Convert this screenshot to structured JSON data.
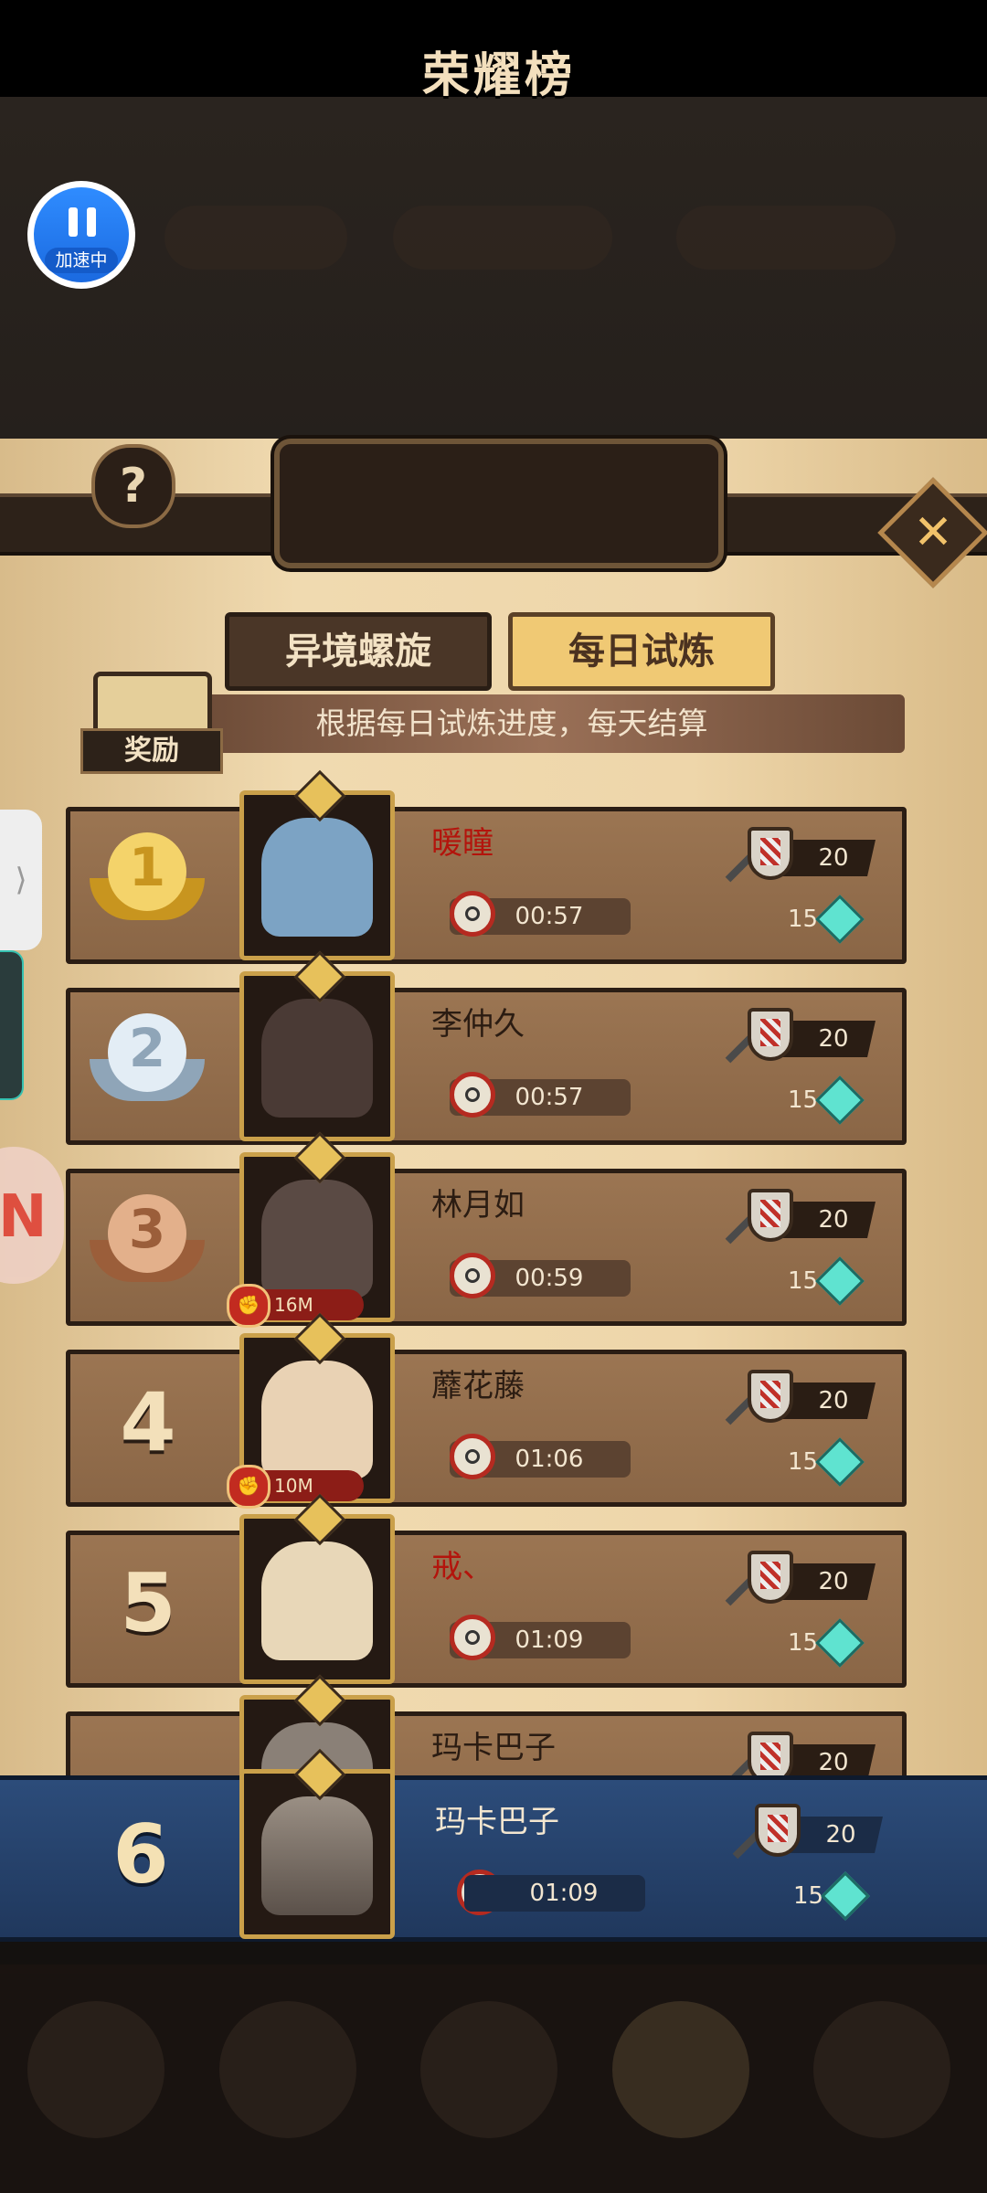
{
  "overlay": {
    "speed_badge_label": "加速中"
  },
  "panel": {
    "title": "荣耀榜",
    "help_label": "?",
    "close_label": "✕",
    "tabs": [
      {
        "label": "异境螺旋",
        "active": false
      },
      {
        "label": "每日试炼",
        "active": true
      }
    ],
    "reward_label": "奖励",
    "subtitle": "根据每日试炼进度，每天结算"
  },
  "rows": [
    {
      "rank": "1",
      "name": "暖瞳",
      "name_red": true,
      "time": "00:57",
      "shield": "20",
      "gem": "15",
      "power": ""
    },
    {
      "rank": "2",
      "name": "李仲久",
      "name_red": false,
      "time": "00:57",
      "shield": "20",
      "gem": "15",
      "power": ""
    },
    {
      "rank": "3",
      "name": "林月如",
      "name_red": false,
      "time": "00:59",
      "shield": "20",
      "gem": "15",
      "power": "16M"
    },
    {
      "rank": "4",
      "name": "蘼花藤",
      "name_red": false,
      "time": "01:06",
      "shield": "20",
      "gem": "15",
      "power": "10M"
    },
    {
      "rank": "5",
      "name": "戒、",
      "name_red": true,
      "time": "01:09",
      "shield": "20",
      "gem": "15",
      "power": ""
    },
    {
      "rank": "",
      "name": "玛卡巴子",
      "name_red": false,
      "time": "",
      "shield": "20",
      "gem": "",
      "power": ""
    }
  ],
  "self": {
    "rank": "6",
    "name": "玛卡巴子",
    "time": "01:09",
    "shield": "20",
    "gem": "15"
  },
  "colors": {
    "gold": "#e7c15b",
    "silver": "#c9d6e3",
    "bronze": "#c98a5e",
    "self_row": "#2c4c7a"
  }
}
